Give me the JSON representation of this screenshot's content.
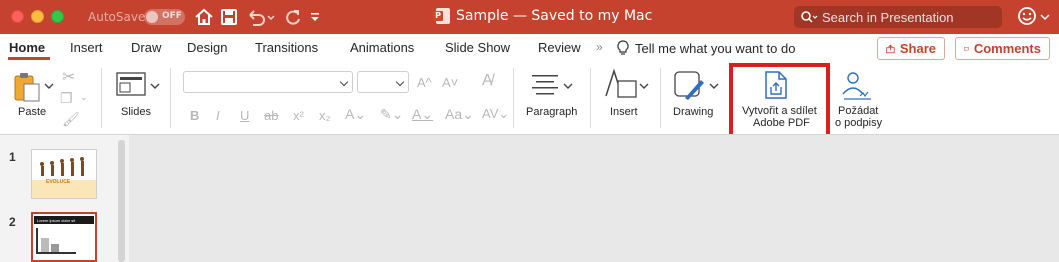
{
  "titlebar": {
    "autosave_label": "AutoSave",
    "autosave_state": "OFF",
    "document_title": "Sample — Saved to my Mac",
    "search_placeholder": "Search in Presentation",
    "accent_color": "#c5432e"
  },
  "tabs": [
    {
      "label": "Home",
      "active": true
    },
    {
      "label": "Insert"
    },
    {
      "label": "Draw"
    },
    {
      "label": "Design"
    },
    {
      "label": "Transitions"
    },
    {
      "label": "Animations"
    },
    {
      "label": "Slide Show"
    },
    {
      "label": "Review"
    }
  ],
  "tell_me": "Tell me what you want to do",
  "actions": {
    "share": "Share",
    "comments": "Comments"
  },
  "ribbon": {
    "paste": "Paste",
    "slides": "Slides",
    "paragraph": "Paragraph",
    "insert": "Insert",
    "drawing": "Drawing",
    "create_share_pdf_line1": "Vytvořit a sdílet",
    "create_share_pdf_line2": "Adobe PDF",
    "request_signatures_line1": "Požádat",
    "request_signatures_line2": "o podpisy",
    "font_size_up": "A^",
    "font_size_down": "A˅",
    "bold": "B",
    "italic": "I",
    "underline": "U",
    "strikethrough": "ab",
    "superscript": "x²",
    "subscript": "x₂"
  },
  "slides": [
    {
      "number": "1",
      "thumb_text": "EVOLUCE"
    },
    {
      "number": "2",
      "thumb_text": "Lorem ipsum dolor sit",
      "selected": true
    }
  ],
  "icons": [
    "home-icon",
    "save-icon",
    "undo-icon",
    "redo-icon",
    "search-icon",
    "smiley-icon",
    "lightbulb-icon",
    "share-icon",
    "comment-icon",
    "pdf-share-icon",
    "signature-icon"
  ]
}
